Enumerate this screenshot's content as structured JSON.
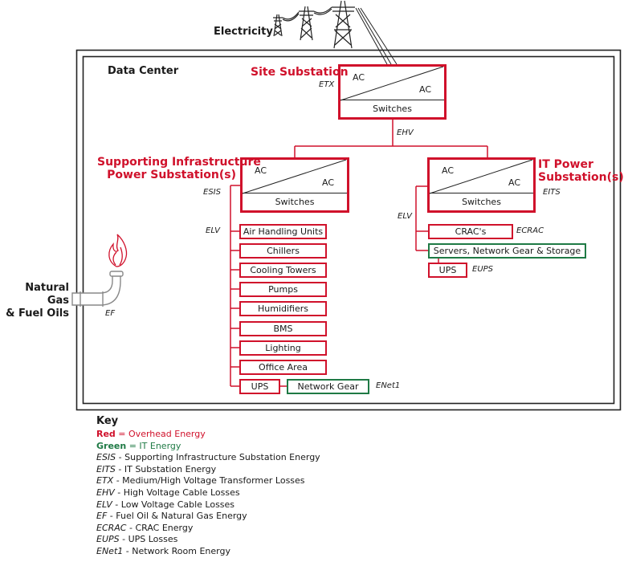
{
  "colors": {
    "overhead_red": "#d0112b",
    "it_green": "#1f7a45",
    "frame": "#222222"
  },
  "external": {
    "electricity_label": "Electricity",
    "natural_gas_label_line1": "Natural Gas",
    "natural_gas_label_line2": "& Fuel Oils",
    "ef_label": "EF"
  },
  "data_center": {
    "title": "Data Center"
  },
  "site_substation": {
    "title": "Site Substation",
    "energy_label": "ETX",
    "ac_top": "AC",
    "ac_bottom": "AC",
    "switches": "Switches",
    "cable_label": "EHV"
  },
  "supporting_substation": {
    "title_line1": "Supporting Infrastructure",
    "title_line2": "Power Substation(s)",
    "energy_label": "ESIS",
    "ac_top": "AC",
    "ac_bottom": "AC",
    "switches": "Switches",
    "cable_label": "ELV",
    "loads": [
      {
        "label": "Air Handling Units",
        "category": "red"
      },
      {
        "label": "Chillers",
        "category": "red"
      },
      {
        "label": "Cooling Towers",
        "category": "red"
      },
      {
        "label": "Pumps",
        "category": "red"
      },
      {
        "label": "Humidifiers",
        "category": "red"
      },
      {
        "label": "BMS",
        "category": "red"
      },
      {
        "label": "Lighting",
        "category": "red"
      },
      {
        "label": "Office Area",
        "category": "red"
      },
      {
        "label": "UPS",
        "category": "red"
      }
    ],
    "network_gear": {
      "label": "Network Gear",
      "category": "green",
      "energy_label": "ENet1"
    }
  },
  "it_substation": {
    "title_line1": "IT Power",
    "title_line2": "Substation(s)",
    "energy_label": "EITS",
    "ac_top": "AC",
    "ac_bottom": "AC",
    "switches": "Switches",
    "cable_label": "ELV",
    "crac": {
      "label": "CRAC's",
      "category": "red",
      "energy_label": "ECRAC"
    },
    "servers": {
      "label": "Servers, Network Gear & Storage",
      "category": "green"
    },
    "ups": {
      "label": "UPS",
      "category": "red",
      "energy_label": "EUPS"
    }
  },
  "key": {
    "title": "Key",
    "red_word": "Red",
    "red_desc": " = Overhead Energy",
    "green_word": "Green",
    "green_desc": " = IT Energy",
    "entries": [
      {
        "abbr": "ESIS",
        "desc": " - Supporting Infrastructure Substation Energy"
      },
      {
        "abbr": "EITS",
        "desc": " - IT Substation Energy"
      },
      {
        "abbr": "ETX",
        "desc": " - Medium/High Voltage Transformer Losses"
      },
      {
        "abbr": "EHV",
        "desc": " - High Voltage Cable Losses"
      },
      {
        "abbr": "ELV",
        "desc": " - Low Voltage Cable Losses"
      },
      {
        "abbr": "EF",
        "desc": " - Fuel Oil & Natural Gas Energy"
      },
      {
        "abbr": "ECRAC",
        "desc": " - CRAC Energy"
      },
      {
        "abbr": "EUPS",
        "desc": " - UPS Losses"
      },
      {
        "abbr": "ENet1",
        "desc": " - Network Room Energy"
      }
    ]
  }
}
